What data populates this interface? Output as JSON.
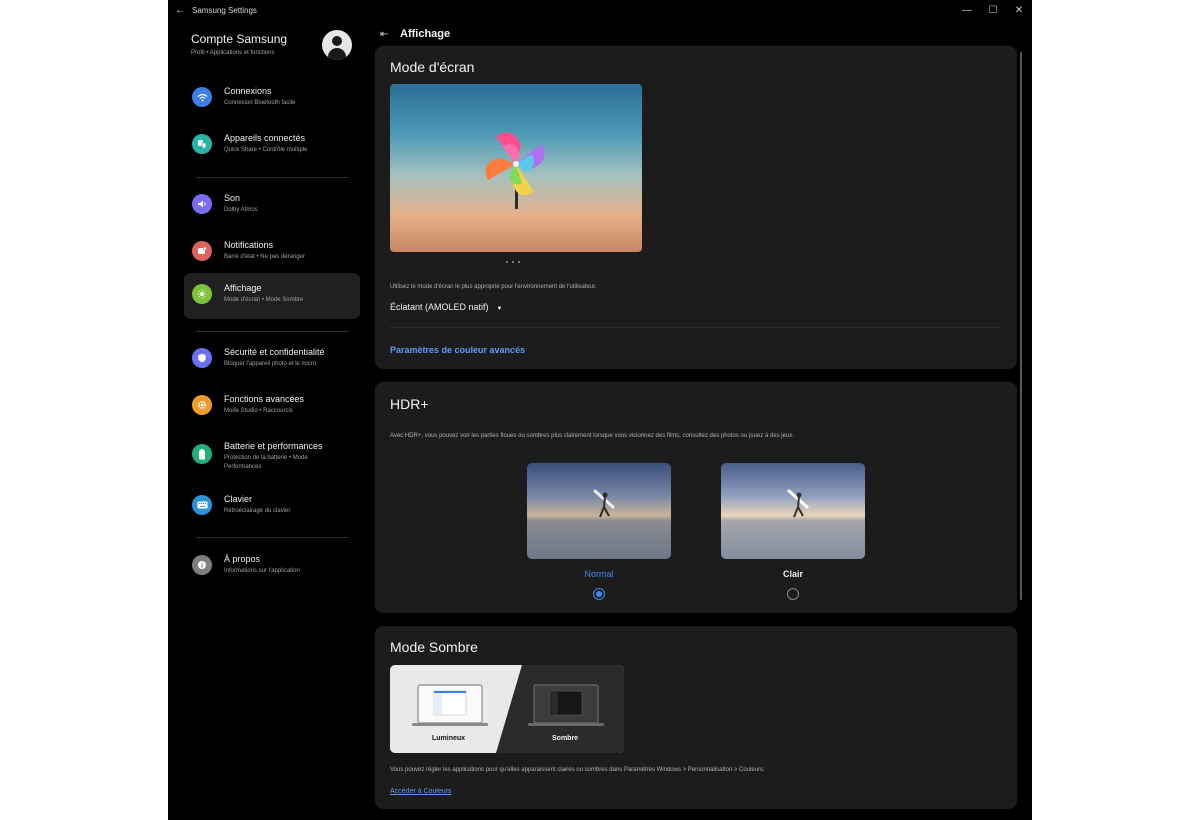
{
  "window": {
    "title": "Samsung Settings",
    "minimize": "—",
    "maximize": "☐",
    "close": "✕",
    "back": "←"
  },
  "account": {
    "name": "Compte Samsung",
    "subtitle": "Profil • Applications et fonctions"
  },
  "sidebar": {
    "items": [
      {
        "label": "Connexions",
        "sub": "Connexion Bluetooth facile",
        "icon": "wifi-icon",
        "color": "#3d7fe6"
      },
      {
        "label": "Appareils connectés",
        "sub": "Quick Share  •  Contrôle multiple",
        "icon": "devices-icon",
        "color": "#2bb3a6"
      },
      {
        "label": "Son",
        "sub": "Dolby Atmos",
        "icon": "sound-icon",
        "color": "#7a6cf0"
      },
      {
        "label": "Notifications",
        "sub": "Barre d'état  •  Ne pas déranger",
        "icon": "notification-icon",
        "color": "#e0625c"
      },
      {
        "label": "Affichage",
        "sub": "Mode d'écran  •  Mode Sombre",
        "icon": "display-icon",
        "color": "#7fc23a"
      },
      {
        "label": "Sécurité et confidentialité",
        "sub": "Bloquer l'appareil photo et le micro",
        "icon": "shield-icon",
        "color": "#6b6ff2"
      },
      {
        "label": "Fonctions avancées",
        "sub": "Mode Studio  •  Raccourcis",
        "icon": "advanced-icon",
        "color": "#ef9b2c"
      },
      {
        "label": "Batterie et performances",
        "sub": "Protection de la batterie  •  Mode Performances",
        "icon": "battery-icon",
        "color": "#22b07a"
      },
      {
        "label": "Clavier",
        "sub": "Rétroéclairage du clavier",
        "icon": "keyboard-icon",
        "color": "#2d93d8"
      },
      {
        "label": "À propos",
        "sub": "Informations sur l'application",
        "icon": "info-icon",
        "color": "#7f7f7f"
      }
    ]
  },
  "main": {
    "title": "Affichage",
    "screen_mode": {
      "title": "Mode d'écran",
      "description": "Utilisez le mode d'écran le plus approprié pour l'environnement de l'utilisateur.",
      "selected": "Éclatant (AMOLED natif)",
      "advanced_link": "Paramètres de couleur avancés"
    },
    "hdr": {
      "title": "HDR+",
      "description": "Avec HDR+, vous pouvez voir les parties floues ou sombres plus clairement lorsque vous visionnez des films, consultez des photos ou jouez à des jeux.",
      "options": [
        {
          "label": "Normal",
          "selected": true
        },
        {
          "label": "Clair",
          "selected": false
        }
      ]
    },
    "dark_mode": {
      "title": "Mode Sombre",
      "light_label": "Lumineux",
      "dark_label": "Sombre",
      "description": "Vous pouvez régler les applications pour qu'elles apparaissent claires ou sombres dans Paramètres Windows > Personnalisation > Couleurs.",
      "link": "Accéder à Couleurs"
    }
  },
  "colors": {
    "accent": "#3d8bf2",
    "link": "#5b9cf5",
    "card": "#1c1c1c",
    "background": "#000000"
  }
}
